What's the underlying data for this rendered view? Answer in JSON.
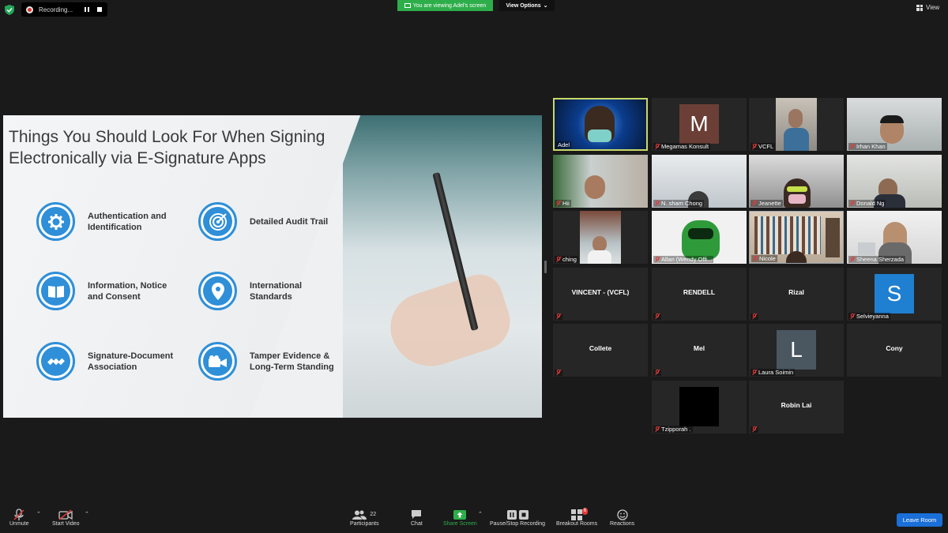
{
  "topbar": {
    "recording_label": "Recording...",
    "viewing_banner": "You are viewing Adel's screen",
    "view_options_label": "View Options",
    "view_label": "View"
  },
  "slide": {
    "title": "Things You Should Look For When Signing Electronically via E-Signature Apps",
    "items": [
      {
        "label": "Authentication and Identification",
        "icon": "gear-icon"
      },
      {
        "label": "Detailed Audit Trail",
        "icon": "target-icon"
      },
      {
        "label": "Information, Notice and Consent",
        "icon": "book-icon"
      },
      {
        "label": "International Standards",
        "icon": "location-pin-icon"
      },
      {
        "label": "Signature-Document Association",
        "icon": "satellite-icon"
      },
      {
        "label": "Tamper Evidence & Long-Term Standing",
        "icon": "video-camera-icon"
      }
    ],
    "accent_color": "#2f8fd8"
  },
  "participants_grid": [
    {
      "name": "Adel",
      "type": "video",
      "active": true
    },
    {
      "name": "Megamas Konsult",
      "type": "avatar",
      "initial": "M",
      "color": "#6b3f36"
    },
    {
      "name": "VCFL",
      "type": "video"
    },
    {
      "name": "Irhan Khan",
      "type": "video"
    },
    {
      "name": "Hii",
      "type": "video"
    },
    {
      "name": "N..sham Chong",
      "type": "video"
    },
    {
      "name": "Jeanette",
      "type": "video"
    },
    {
      "name": "Donald Ng",
      "type": "video"
    },
    {
      "name": "ching",
      "type": "video"
    },
    {
      "name": "Allan (Wendy Offi...",
      "type": "video"
    },
    {
      "name": "Nicole",
      "type": "video"
    },
    {
      "name": "Sheena Sherzada",
      "type": "video"
    },
    {
      "name": "VINCENT - (VCFL)",
      "type": "name"
    },
    {
      "name": "RENDELL",
      "type": "name"
    },
    {
      "name": "Rizal",
      "type": "name"
    },
    {
      "name": "Selvieyanna",
      "type": "avatar",
      "initial": "S",
      "color": "#1f7fd0"
    },
    {
      "name": "Collete",
      "type": "name"
    },
    {
      "name": "Mel",
      "type": "name"
    },
    {
      "name": "Laura Soimin",
      "type": "avatar",
      "initial": "L",
      "color": "#4a5660"
    },
    {
      "name": "Cony",
      "type": "name"
    },
    {
      "name": "Tzipporah .",
      "type": "avatar",
      "initial": "",
      "color": "#000000"
    },
    {
      "name": "Robin Lai",
      "type": "name"
    }
  ],
  "toolbar": {
    "unmute": "Unmute",
    "start_video": "Start Video",
    "participants": "Participants",
    "participants_count": "22",
    "chat": "Chat",
    "share_screen": "Share Screen",
    "pause_stop_recording": "Pause/Stop Recording",
    "breakout_rooms": "Breakout Rooms",
    "breakout_badge": "6",
    "reactions": "Reactions",
    "leave_room": "Leave Room"
  }
}
